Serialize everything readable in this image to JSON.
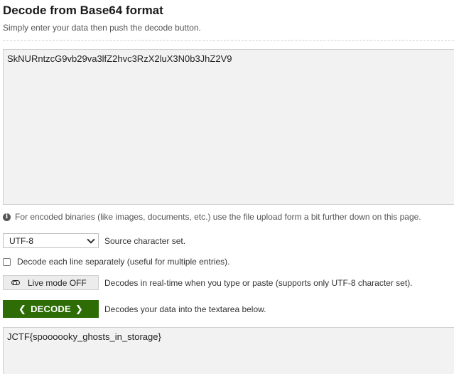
{
  "header": {
    "title": "Decode from Base64 format",
    "subtitle": "Simply enter your data then push the decode button."
  },
  "input": {
    "value": "SkNURntzcG9vb29va3lfZ2hvc3RzX2luX3N0b3JhZ2V9"
  },
  "note": {
    "icon": "info-icon",
    "text": "For encoded binaries (like images, documents, etc.) use the file upload form a bit further down on this page."
  },
  "charset": {
    "selected": "UTF-8",
    "label": "Source character set."
  },
  "decode_each_line": {
    "checked": false,
    "label": "Decode each line separately (useful for multiple entries)."
  },
  "live_mode": {
    "button_label": "Live mode OFF",
    "description": "Decodes in real-time when you type or paste (supports only UTF-8 character set)."
  },
  "decode": {
    "button_label": "DECODE",
    "description": "Decodes your data into the textarea below.",
    "color": "#2e6d06"
  },
  "output": {
    "value": "JCTF{spoooooky_ghosts_in_storage}"
  }
}
